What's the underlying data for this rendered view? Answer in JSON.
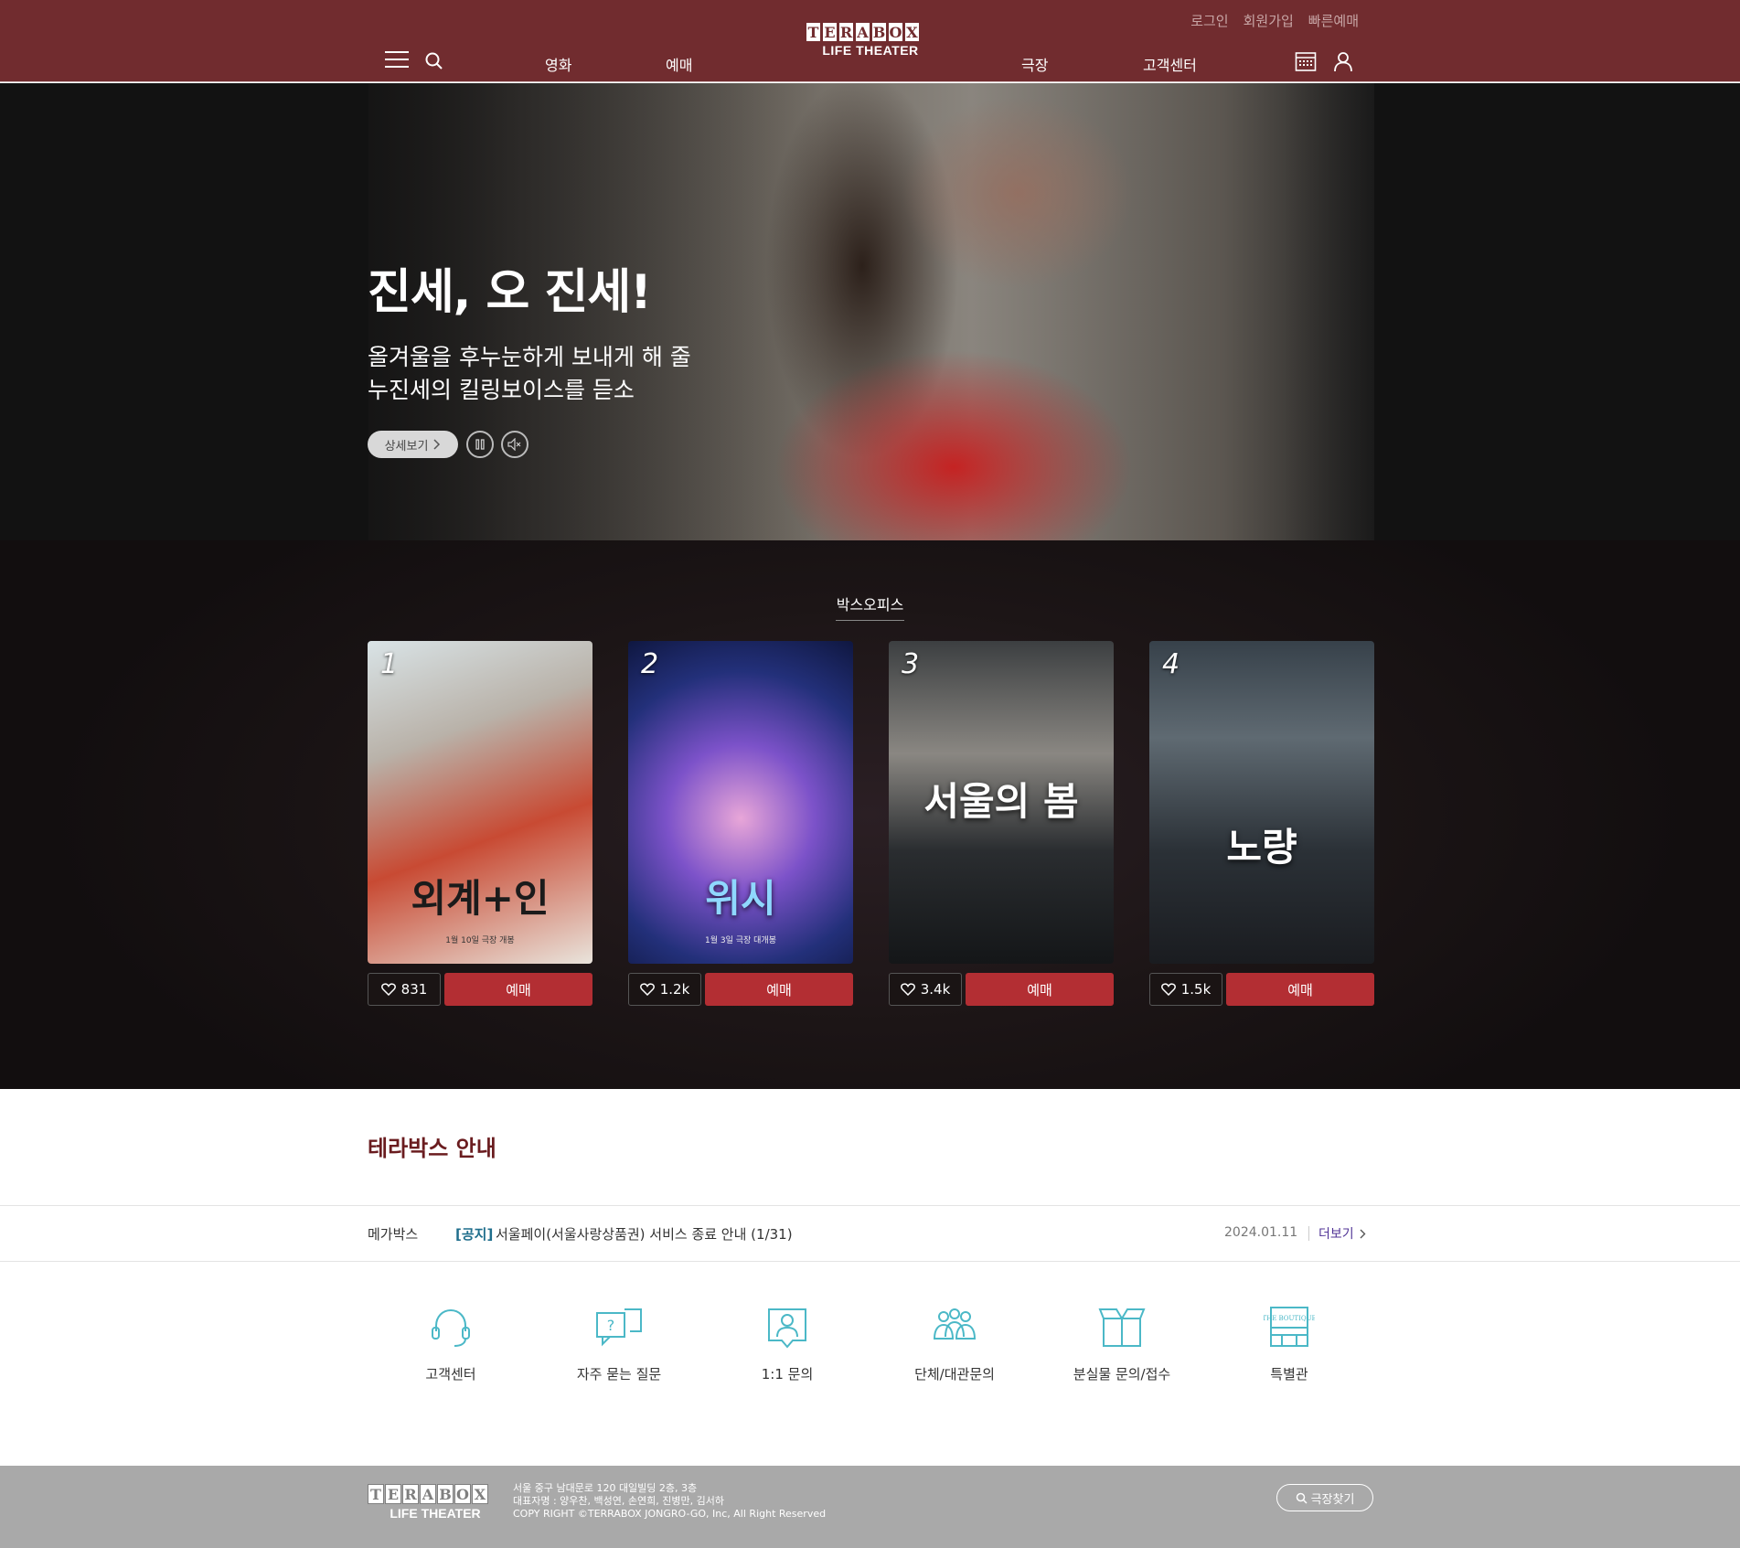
{
  "header": {
    "util_links": [
      "로그인",
      "회원가입",
      "빠른예매"
    ],
    "logo_letters": [
      "T",
      "E",
      "R",
      "A",
      "B",
      "O",
      "X"
    ],
    "logo_sub": "LIFE THEATER",
    "nav": [
      "영화",
      "예매",
      "극장",
      "고객센터"
    ],
    "icons": [
      "menu-icon",
      "search-icon",
      "calendar-icon",
      "user-icon"
    ]
  },
  "hero": {
    "title": "진세, 오 진세!",
    "desc_line1": "올겨울을 후누눈하게 보내게 해 줄",
    "desc_line2": "누진세의 킬링보이스를 듣소",
    "detail_label": "상세보기",
    "controls": [
      "pause-icon",
      "mute-icon"
    ]
  },
  "boxoffice": {
    "title": "박스오피스",
    "movies": [
      {
        "rank": "1",
        "title": "외계+인",
        "sub": "1월 10일 극장 개봉",
        "likes": "831",
        "book_label": "예매"
      },
      {
        "rank": "2",
        "title": "위시",
        "sub": "1월 3일 극장 대개봉",
        "likes": "1.2k",
        "book_label": "예매"
      },
      {
        "rank": "3",
        "title": "서울의 봄",
        "sub": "",
        "likes": "3.4k",
        "book_label": "예매"
      },
      {
        "rank": "4",
        "title": "노량",
        "sub": "",
        "likes": "1.5k",
        "book_label": "예매"
      }
    ]
  },
  "info": {
    "title": "테라박스 안내",
    "notice": {
      "source": "메가박스",
      "tag": "[공지]",
      "text": "서울페이(서울사랑상품권) 서비스 종료 안내 (1/31)",
      "date": "2024.01.11",
      "more": "더보기"
    },
    "quick_links": [
      "고객센터",
      "자주 묻는 질문",
      "1:1 문의",
      "단체/대관문의",
      "분실물 문의/접수",
      "특별관"
    ]
  },
  "footer": {
    "logo_letters": [
      "T",
      "E",
      "R",
      "A",
      "B",
      "O",
      "X"
    ],
    "logo_sub": "LIFE THEATER",
    "address": "서울 중구 남대문로 120 대일빌딩 2층, 3층",
    "reps": "대표자명 : 양우찬, 백성연, 손연희, 진병만, 김서하",
    "copyright": "COPY RIGHT ©TERRABOX JONGRO-GO, Inc, All Right Reserved",
    "find_label": "극장찾기"
  },
  "colors": {
    "brand": "#712c2f",
    "book": "#b32e33",
    "footer": "#a9a9a9"
  }
}
